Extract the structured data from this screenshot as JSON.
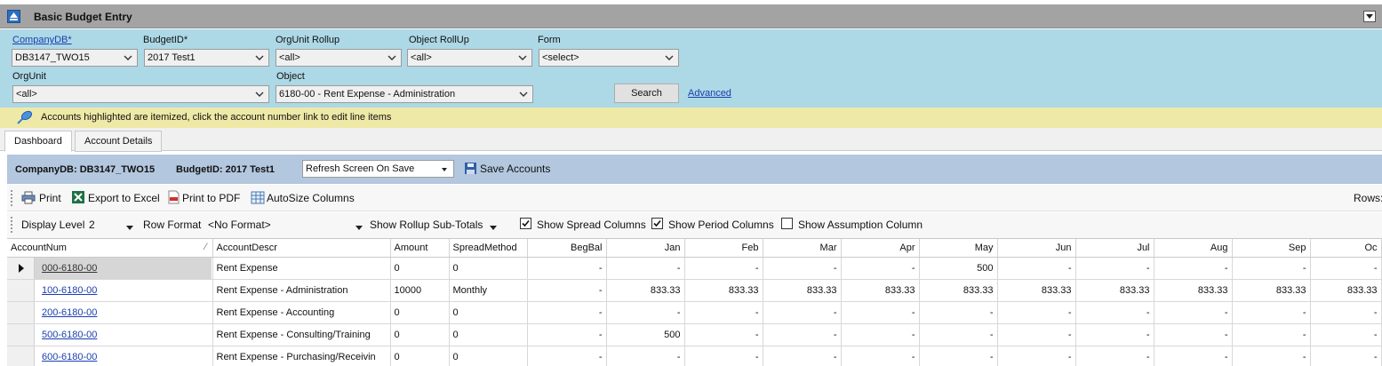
{
  "window": {
    "title": "Basic Budget Entry"
  },
  "filters": {
    "company": {
      "label": "CompanyDB*",
      "value": "DB3147_TWO15"
    },
    "budget": {
      "label": "BudgetID*",
      "value": "2017 Test1"
    },
    "orgunit_rollup": {
      "label": "OrgUnit Rollup",
      "value": "<all>"
    },
    "object_rollup": {
      "label": "Object RollUp",
      "value": "<all>"
    },
    "form": {
      "label": "Form",
      "value": "<select>"
    },
    "orgunit": {
      "label": "OrgUnit",
      "value": "<all>"
    },
    "object": {
      "label": "Object",
      "value": "6180-00 - Rent Expense - Administration"
    },
    "search_label": "Search",
    "advanced_label": "Advanced"
  },
  "info": {
    "text": "Accounts highlighted are itemized, click the account number link to edit line items"
  },
  "tabs": [
    {
      "label": "Dashboard"
    },
    {
      "label": "Account Details"
    }
  ],
  "summary": {
    "company_text": "CompanyDB: DB3147_TWO15",
    "budget_text": "BudgetID: 2017 Test1",
    "refresh_option": "Refresh Screen On Save",
    "save_label": "Save Accounts"
  },
  "toolbar": {
    "print": "Print",
    "export": "Export to Excel",
    "pdf": "Print to PDF",
    "autosize": "AutoSize Columns",
    "rows_label": "Rows:"
  },
  "options": {
    "display_level_label": "Display Level",
    "display_level_value": "2",
    "row_format_label": "Row Format",
    "row_format_value": "<No Format>",
    "rollup_label": "Show Rollup Sub-Totals",
    "spread_label": "Show Spread Columns",
    "spread_checked": true,
    "period_label": "Show Period Columns",
    "period_checked": true,
    "assumption_label": "Show Assumption Column",
    "assumption_checked": false
  },
  "grid": {
    "columns": [
      "AccountNum",
      "AccountDescr",
      "Amount",
      "SpreadMethod",
      "BegBal",
      "Jan",
      "Feb",
      "Mar",
      "Apr",
      "May",
      "Jun",
      "Jul",
      "Aug",
      "Sep",
      "Oc"
    ],
    "rows": [
      {
        "account": "000-6180-00",
        "descr": "Rent Expense",
        "amount": "0",
        "spread": "0",
        "vals": [
          "-",
          "-",
          "-",
          "-",
          "-",
          "500",
          "-",
          "-",
          "-",
          "-",
          "-"
        ]
      },
      {
        "account": "100-6180-00",
        "descr": "Rent Expense - Administration",
        "amount": "10000",
        "spread": "Monthly",
        "vals": [
          "-",
          "833.33",
          "833.33",
          "833.33",
          "833.33",
          "833.33",
          "833.33",
          "833.33",
          "833.33",
          "833.33",
          "833.33"
        ]
      },
      {
        "account": "200-6180-00",
        "descr": "Rent Expense - Accounting",
        "amount": "0",
        "spread": "0",
        "vals": [
          "-",
          "-",
          "-",
          "-",
          "-",
          "-",
          "-",
          "-",
          "-",
          "-",
          "-"
        ]
      },
      {
        "account": "500-6180-00",
        "descr": "Rent Expense - Consulting/Training",
        "amount": "0",
        "spread": "0",
        "vals": [
          "-",
          "500",
          "-",
          "-",
          "-",
          "-",
          "-",
          "-",
          "-",
          "-",
          "-"
        ]
      },
      {
        "account": "600-6180-00",
        "descr": "Rent Expense - Purchasing/Receivin",
        "amount": "0",
        "spread": "0",
        "vals": [
          "-",
          "-",
          "-",
          "-",
          "-",
          "-",
          "-",
          "-",
          "-",
          "-",
          "-"
        ]
      }
    ]
  }
}
